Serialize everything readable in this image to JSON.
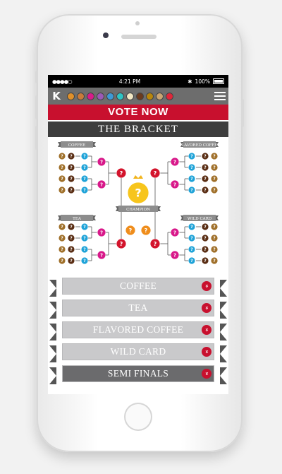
{
  "status_bar": {
    "signal": "●●●●○",
    "time": "4:21 PM",
    "battery": "100%"
  },
  "header": {
    "logo": "K",
    "colors": [
      "#e0902a",
      "#c87a3a",
      "#d81b8a",
      "#9b59b6",
      "#3d9ad6",
      "#2ec4c4",
      "#f2e7c4",
      "#6b3a1e",
      "#b8860b",
      "#c9a472",
      "#e0263a"
    ]
  },
  "vote_label": "VOTE NOW",
  "bracket_title": "THE BRACKET",
  "bracket": {
    "labels": {
      "coffee": "COFFEE",
      "flavored": "FLAVORED COFFEE",
      "tea": "TEA",
      "wildcard": "WILD CARD",
      "champion": "CHAMPION"
    },
    "mark": "?"
  },
  "banners": [
    {
      "label": "COFFEE",
      "dark": false
    },
    {
      "label": "TEA",
      "dark": false
    },
    {
      "label": "FLAVORED COFFEE",
      "dark": false
    },
    {
      "label": "WILD CARD",
      "dark": false
    },
    {
      "label": "SEMI FINALS",
      "dark": true
    }
  ],
  "badge_icon": "chevron-down-icon"
}
